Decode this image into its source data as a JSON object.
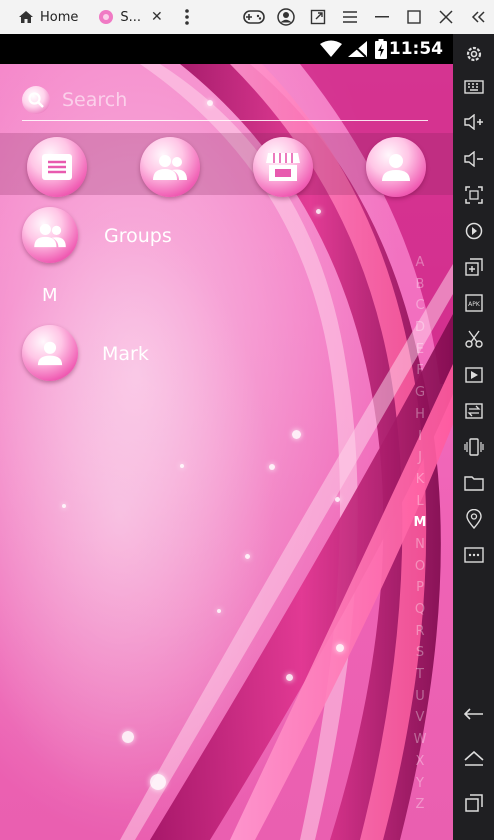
{
  "emulator": {
    "home_tab_label": "Home",
    "app_tab_label": "S...",
    "app_tab_close": "✕",
    "sidebar_icons": [
      "collapse-icon",
      "settings-icon",
      "keyboard-icon",
      "volume-up-icon",
      "volume-down-icon",
      "screenshot-icon",
      "rotate-icon",
      "multi-instance-icon",
      "apk-icon",
      "scissors-icon",
      "record-icon",
      "sync-icon",
      "shake-icon",
      "folder-icon",
      "location-icon",
      "more-icon",
      "back-icon",
      "home-icon",
      "recents-icon"
    ]
  },
  "status_bar": {
    "time": "11:54"
  },
  "search": {
    "placeholder": "Search",
    "value": ""
  },
  "tabs": [
    {
      "name": "dialpad-tab",
      "icon": "list-icon"
    },
    {
      "name": "groups-tab",
      "icon": "people-icon"
    },
    {
      "name": "store-tab",
      "icon": "store-icon"
    },
    {
      "name": "contacts-tab",
      "icon": "person-icon"
    }
  ],
  "list": {
    "groups_label": "Groups",
    "section_header": "M",
    "contact_name": "Mark"
  },
  "index_letters": [
    "A",
    "B",
    "C",
    "D",
    "E",
    "F",
    "G",
    "H",
    "I",
    "J",
    "K",
    "L",
    "M",
    "N",
    "O",
    "P",
    "Q",
    "R",
    "S",
    "T",
    "U",
    "V",
    "W",
    "X",
    "Y",
    "Z"
  ],
  "active_index_letter": "M",
  "colors": {
    "background_pink": "#f26fbf",
    "accent_magenta": "#d23b94",
    "sidebar": "#1f1f22"
  }
}
